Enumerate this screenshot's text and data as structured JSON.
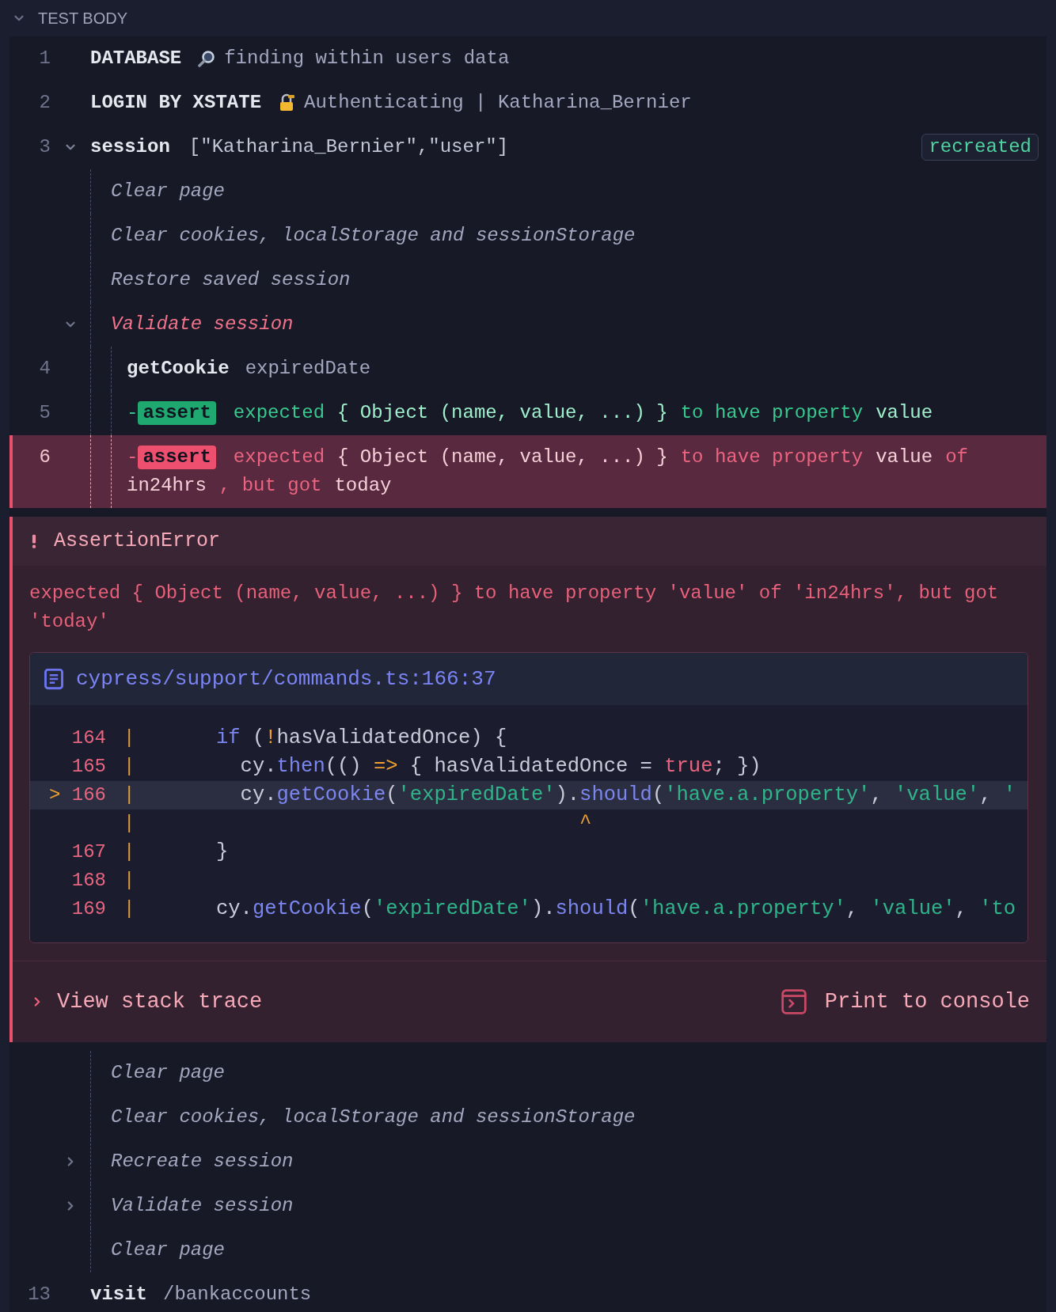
{
  "section": {
    "title": "TEST BODY",
    "expanded": true
  },
  "commands": [
    {
      "kind": "command",
      "number": "1",
      "name": "DATABASE",
      "message": "finding within users data"
    },
    {
      "kind": "command",
      "number": "2",
      "name": "LOGIN BY XSTATE",
      "message": "Authenticating | Katharina_Bernier"
    },
    {
      "kind": "session",
      "number": "3",
      "name": "session",
      "message": "[\"Katharina_Bernier\",\"user\"]",
      "badge": "recreated",
      "expanded": true,
      "children": [
        {
          "kind": "step",
          "label": "Clear page"
        },
        {
          "kind": "step",
          "label": "Clear cookies, localStorage and sessionStorage"
        },
        {
          "kind": "step",
          "label": "Restore saved session"
        },
        {
          "kind": "group",
          "label": "Validate session",
          "failed": true,
          "expanded": true,
          "children": [
            {
              "kind": "command",
              "number": "4",
              "name": "getCookie",
              "message": "expiredDate"
            },
            {
              "kind": "assert",
              "number": "5",
              "failed": false,
              "dash": "-",
              "badge": "assert",
              "parts": [
                {
                  "text": "expected",
                  "kind": "keyword"
                },
                {
                  "text": "{ Object (name, value, ...) }",
                  "kind": "value"
                },
                {
                  "text": "to have property",
                  "kind": "keyword"
                },
                {
                  "text": "value",
                  "kind": "value"
                }
              ]
            },
            {
              "kind": "assert",
              "number": "6",
              "failed": true,
              "dash": "-",
              "badge": "assert",
              "parts": [
                {
                  "text": "expected",
                  "kind": "keyword"
                },
                {
                  "text": "{ Object (name, value, ...) }",
                  "kind": "value"
                },
                {
                  "text": "to have property",
                  "kind": "keyword"
                },
                {
                  "text": "value",
                  "kind": "value"
                },
                {
                  "text": "of",
                  "kind": "keyword"
                },
                {
                  "text": "in24hrs",
                  "kind": "value"
                },
                {
                  "text": ", but got",
                  "kind": "keyword"
                },
                {
                  "text": "today",
                  "kind": "value"
                }
              ],
              "error": {
                "title": "AssertionError",
                "message": "expected { Object (name, value, ...) } to have property 'value' of 'in24hrs', but got 'today'",
                "file": "cypress/support/commands.ts:166:37",
                "code_lines": [
                  {
                    "number": "164",
                    "gutter": "|",
                    "current": false,
                    "tokens": [
                      {
                        "text": "if",
                        "kind": "keyword"
                      },
                      {
                        "text": " (",
                        "kind": "plain"
                      },
                      {
                        "text": "!",
                        "kind": "operator"
                      },
                      {
                        "text": "hasValidatedOnce) {",
                        "kind": "plain"
                      }
                    ]
                  },
                  {
                    "number": "165",
                    "gutter": "|",
                    "current": false,
                    "tokens": [
                      {
                        "text": "  cy.",
                        "kind": "plain"
                      },
                      {
                        "text": "then",
                        "kind": "function"
                      },
                      {
                        "text": "(() ",
                        "kind": "plain"
                      },
                      {
                        "text": "=>",
                        "kind": "operator"
                      },
                      {
                        "text": " { hasValidatedOnce = ",
                        "kind": "plain"
                      },
                      {
                        "text": "true",
                        "kind": "literal"
                      },
                      {
                        "text": "; })",
                        "kind": "plain"
                      }
                    ]
                  },
                  {
                    "marker": ">",
                    "number": "166",
                    "gutter": "|",
                    "current": true,
                    "tokens": [
                      {
                        "text": "  cy.",
                        "kind": "plain"
                      },
                      {
                        "text": "getCookie",
                        "kind": "function"
                      },
                      {
                        "text": "(",
                        "kind": "plain"
                      },
                      {
                        "text": "'expiredDate'",
                        "kind": "string"
                      },
                      {
                        "text": ").",
                        "kind": "plain"
                      },
                      {
                        "text": "should",
                        "kind": "function"
                      },
                      {
                        "text": "(",
                        "kind": "plain"
                      },
                      {
                        "text": "'have.a.property'",
                        "kind": "string"
                      },
                      {
                        "text": ", ",
                        "kind": "plain"
                      },
                      {
                        "text": "'value'",
                        "kind": "string"
                      },
                      {
                        "text": ", ",
                        "kind": "plain"
                      },
                      {
                        "text": "'",
                        "kind": "string"
                      }
                    ]
                  },
                  {
                    "gutter": "|",
                    "current": false,
                    "tokens": [
                      {
                        "text": "                              ^",
                        "kind": "operator"
                      }
                    ]
                  },
                  {
                    "number": "167",
                    "gutter": "|",
                    "current": false,
                    "tokens": [
                      {
                        "text": "}",
                        "kind": "plain"
                      }
                    ]
                  },
                  {
                    "number": "168",
                    "gutter": "|",
                    "current": false
                  },
                  {
                    "number": "169",
                    "gutter": "|",
                    "current": false,
                    "tokens": [
                      {
                        "text": "cy.",
                        "kind": "plain"
                      },
                      {
                        "text": "getCookie",
                        "kind": "function"
                      },
                      {
                        "text": "(",
                        "kind": "plain"
                      },
                      {
                        "text": "'expiredDate'",
                        "kind": "string"
                      },
                      {
                        "text": ").",
                        "kind": "plain"
                      },
                      {
                        "text": "should",
                        "kind": "function"
                      },
                      {
                        "text": "(",
                        "kind": "plain"
                      },
                      {
                        "text": "'have.a.property'",
                        "kind": "string"
                      },
                      {
                        "text": ", ",
                        "kind": "plain"
                      },
                      {
                        "text": "'value'",
                        "kind": "string"
                      },
                      {
                        "text": ", ",
                        "kind": "plain"
                      },
                      {
                        "text": "'to",
                        "kind": "string"
                      }
                    ]
                  }
                ],
                "stack_trace": {
                  "label": "View stack trace",
                  "expanded": false
                },
                "print_button": "Print to console"
              }
            }
          ]
        },
        {
          "kind": "step",
          "label": "Clear page"
        },
        {
          "kind": "step",
          "label": "Clear cookies, localStorage and sessionStorage"
        },
        {
          "kind": "group",
          "label": "Recreate session",
          "failed": false,
          "expanded": false
        },
        {
          "kind": "group",
          "label": "Validate session",
          "failed": false,
          "expanded": false
        },
        {
          "kind": "step",
          "label": "Clear page"
        }
      ]
    },
    {
      "kind": "command",
      "number": "13",
      "name": "visit",
      "message": "/bankaccounts"
    }
  ]
}
